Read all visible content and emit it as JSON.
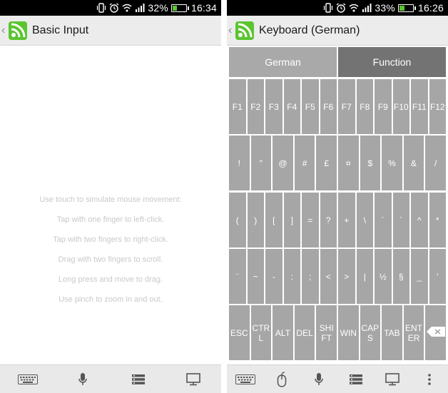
{
  "left_screen": {
    "status": {
      "battery": "32%",
      "battery_level": 0.32,
      "time": "16:34"
    },
    "action_bar": {
      "title": "Basic Input",
      "back_icon": "chevron-left-icon",
      "logo_icon": "remote-app-logo-icon"
    },
    "instructions": [
      "Use touch to simulate mouse movement:",
      "Tap with one finger to left-click.",
      "Tap with two fingers to right-click.",
      "Drag with two fingers to scroll.",
      "Long press and move to drag.",
      "Use pinch to zoom in and out."
    ],
    "bottom_icons": [
      "keyboard-icon",
      "microphone-icon",
      "list-icon",
      "monitor-icon"
    ]
  },
  "right_screen": {
    "status": {
      "battery": "33%",
      "battery_level": 0.33,
      "time": "16:26"
    },
    "action_bar": {
      "title": "Keyboard (German)",
      "back_icon": "chevron-left-icon",
      "logo_icon": "remote-app-logo-icon"
    },
    "tabs": [
      {
        "label": "German",
        "selected": false
      },
      {
        "label": "Function",
        "selected": true
      }
    ],
    "rows": [
      [
        "F1",
        "F2",
        "F3",
        "F4",
        "F5",
        "F6",
        "F7",
        "F8",
        "F9",
        "F10",
        "F11",
        "F12"
      ],
      [
        "!",
        "\"",
        "@",
        "#",
        "£",
        "¤",
        "$",
        "%",
        "&",
        "/"
      ],
      [
        "(",
        ")",
        "[",
        "]",
        "=",
        "?",
        "+",
        "\\",
        "´",
        "`",
        "^",
        "*"
      ],
      [
        "¨",
        "~",
        "-",
        ":",
        ";",
        "<",
        ">",
        "|",
        "½",
        "§",
        "_",
        "'"
      ],
      [
        "ESC",
        "CTR\nL",
        "ALT",
        "DEL",
        "SHI\nFT",
        "WIN",
        "CAP\nS",
        "TAB",
        "ENT\nER"
      ]
    ],
    "backspace_icon": "backspace-icon",
    "bottom_icons": [
      "keyboard-icon",
      "mouse-icon",
      "microphone-icon",
      "list-icon",
      "monitor-icon",
      "overflow-menu-icon"
    ]
  },
  "colors": {
    "accent_green": "#5ac531",
    "key_gray": "#a6a6a6",
    "tab_selected": "#737373"
  }
}
